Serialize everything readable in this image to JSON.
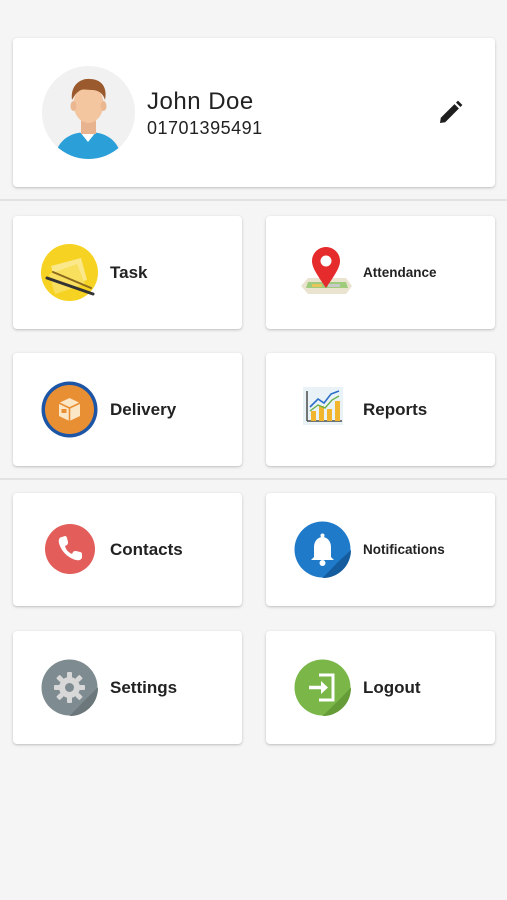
{
  "profile": {
    "name": "John Doe",
    "phone": "01701395491",
    "edit_icon": "pencil-icon"
  },
  "menu": {
    "task": {
      "label": "Task",
      "icon": "sticky-notes-icon"
    },
    "attendance": {
      "label": "Attendance",
      "icon": "map-pin-icon"
    },
    "delivery": {
      "label": "Delivery",
      "icon": "package-icon"
    },
    "reports": {
      "label": "Reports",
      "icon": "chart-report-icon"
    },
    "contacts": {
      "label": "Contacts",
      "icon": "phone-icon"
    },
    "notifications": {
      "label": "Notifications",
      "icon": "bell-icon"
    },
    "settings": {
      "label": "Settings",
      "icon": "gear-icon"
    },
    "logout": {
      "label": "Logout",
      "icon": "logout-icon"
    }
  },
  "colors": {
    "background": "#f5f5f5",
    "card": "#ffffff",
    "contacts_red": "#e35d5b",
    "notifications_blue": "#1f7ac9",
    "settings_gray": "#7e8b90",
    "logout_green": "#7ab648",
    "delivery_orange": "#e98f33"
  }
}
